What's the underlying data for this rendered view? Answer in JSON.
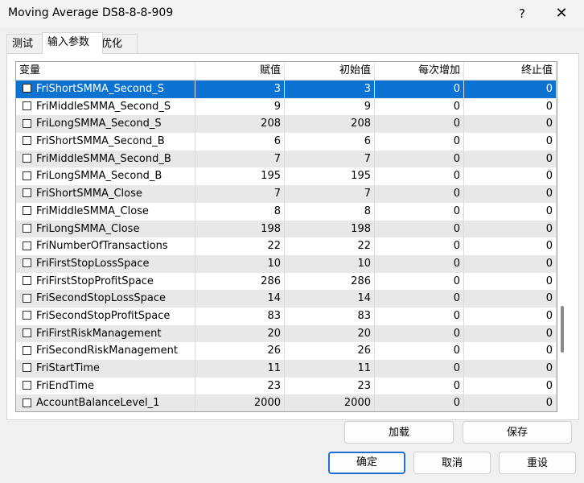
{
  "window": {
    "title": "Moving Average DS8-8-8-909",
    "help": "?",
    "close": "✕"
  },
  "tabs": [
    {
      "label": "测试"
    },
    {
      "label": "输入参数"
    },
    {
      "label": "优化"
    }
  ],
  "table": {
    "columns": [
      "变量",
      "赋值",
      "初始值",
      "每次增加",
      "终止值"
    ],
    "rows": [
      {
        "name": "FriShortSMMA_Second_S",
        "value": "3",
        "start": "3",
        "step": "0",
        "stop": "0"
      },
      {
        "name": "FriMiddleSMMA_Second_S",
        "value": "9",
        "start": "9",
        "step": "0",
        "stop": "0"
      },
      {
        "name": "FriLongSMMA_Second_S",
        "value": "208",
        "start": "208",
        "step": "0",
        "stop": "0"
      },
      {
        "name": "FriShortSMMA_Second_B",
        "value": "6",
        "start": "6",
        "step": "0",
        "stop": "0"
      },
      {
        "name": "FriMiddleSMMA_Second_B",
        "value": "7",
        "start": "7",
        "step": "0",
        "stop": "0"
      },
      {
        "name": "FriLongSMMA_Second_B",
        "value": "195",
        "start": "195",
        "step": "0",
        "stop": "0"
      },
      {
        "name": "FriShortSMMA_Close",
        "value": "7",
        "start": "7",
        "step": "0",
        "stop": "0"
      },
      {
        "name": "FriMiddleSMMA_Close",
        "value": "8",
        "start": "8",
        "step": "0",
        "stop": "0"
      },
      {
        "name": "FriLongSMMA_Close",
        "value": "198",
        "start": "198",
        "step": "0",
        "stop": "0"
      },
      {
        "name": "FriNumberOfTransactions",
        "value": "22",
        "start": "22",
        "step": "0",
        "stop": "0"
      },
      {
        "name": "FriFirstStopLossSpace",
        "value": "10",
        "start": "10",
        "step": "0",
        "stop": "0"
      },
      {
        "name": "FriFirstStopProfitSpace",
        "value": "286",
        "start": "286",
        "step": "0",
        "stop": "0"
      },
      {
        "name": "FriSecondStopLossSpace",
        "value": "14",
        "start": "14",
        "step": "0",
        "stop": "0"
      },
      {
        "name": "FriSecondStopProfitSpace",
        "value": "83",
        "start": "83",
        "step": "0",
        "stop": "0"
      },
      {
        "name": "FriFirstRiskManagement",
        "value": "20",
        "start": "20",
        "step": "0",
        "stop": "0"
      },
      {
        "name": "FriSecondRiskManagement",
        "value": "26",
        "start": "26",
        "step": "0",
        "stop": "0"
      },
      {
        "name": "FriStartTime",
        "value": "11",
        "start": "11",
        "step": "0",
        "stop": "0"
      },
      {
        "name": "FriEndTime",
        "value": "23",
        "start": "23",
        "step": "0",
        "stop": "0"
      },
      {
        "name": "AccountBalanceLevel_1",
        "value": "2000",
        "start": "2000",
        "step": "0",
        "stop": "0"
      }
    ]
  },
  "buttons": {
    "load": "加载",
    "save": "保存",
    "ok": "确定",
    "cancel": "取消",
    "reset": "重设"
  },
  "colors": {
    "selection": "#0d73d2",
    "stripe": "#e8e8e8"
  }
}
